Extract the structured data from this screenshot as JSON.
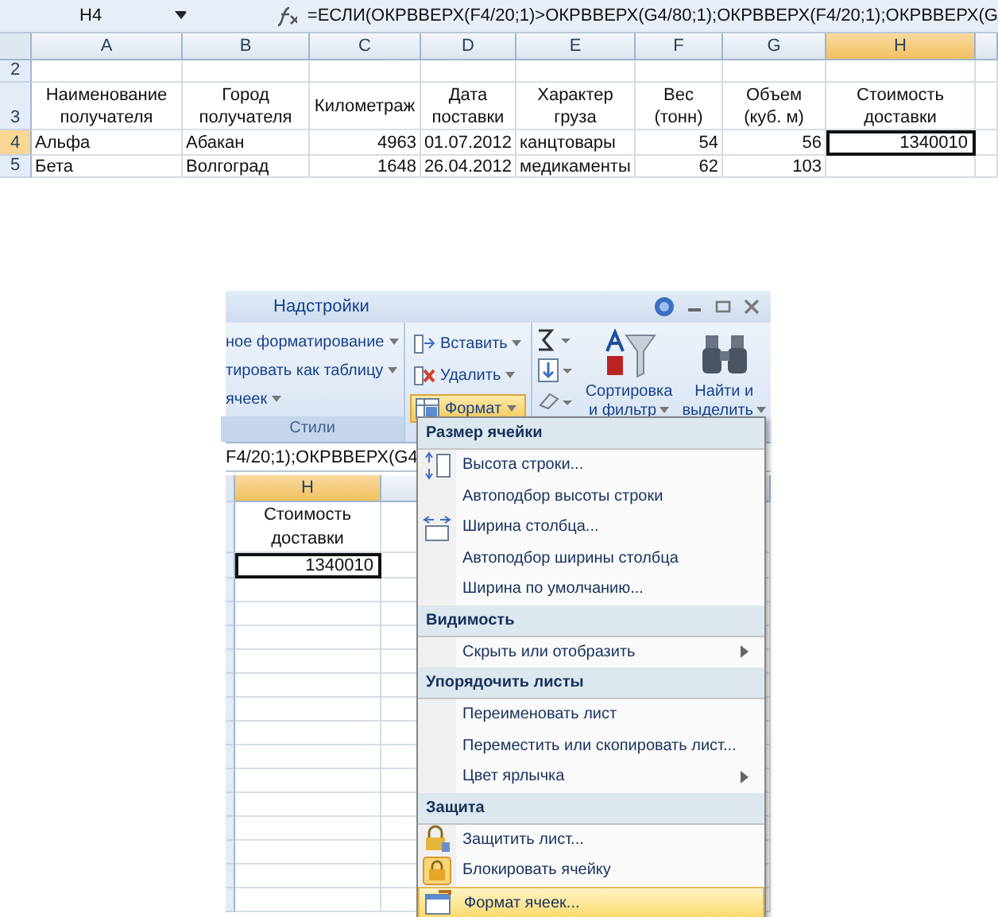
{
  "top_sheet": {
    "name_box": "H4",
    "formula": "=ЕСЛИ(ОКРВВЕРХ(F4/20;1)>ОКРВВЕРХ(G4/80;1);ОКРВВЕРХ(F4/20;1);ОКРВВЕРХ(G",
    "columns": [
      {
        "label": "A",
        "selected": false
      },
      {
        "label": "B",
        "selected": false
      },
      {
        "label": "C",
        "selected": false
      },
      {
        "label": "D",
        "selected": false
      },
      {
        "label": "E",
        "selected": false
      },
      {
        "label": "F",
        "selected": false
      },
      {
        "label": "G",
        "selected": false
      },
      {
        "label": "H",
        "selected": true
      }
    ],
    "rows": [
      {
        "number": "2",
        "selected": false,
        "cells": []
      },
      {
        "number": "3",
        "selected": false,
        "cells": [
          {
            "text": "Наименование получателя",
            "kind": "header"
          },
          {
            "text": "Город получателя",
            "kind": "header"
          },
          {
            "text": "Километраж",
            "kind": "header"
          },
          {
            "text": "Дата поставки",
            "kind": "header"
          },
          {
            "text": "Характер груза",
            "kind": "header"
          },
          {
            "text": "Вес (тонн)",
            "kind": "header"
          },
          {
            "text": "Объем (куб. м)",
            "kind": "header"
          },
          {
            "text": "Стоимость доставки",
            "kind": "header"
          }
        ]
      },
      {
        "number": "4",
        "selected": true,
        "cells": [
          {
            "text": "Альфа",
            "kind": "text",
            "active": false
          },
          {
            "text": "Абакан",
            "kind": "text",
            "active": false
          },
          {
            "text": "4963",
            "kind": "number",
            "active": false
          },
          {
            "text": "01.07.2012",
            "kind": "number",
            "active": false
          },
          {
            "text": "канцтовары",
            "kind": "text",
            "active": false
          },
          {
            "text": "54",
            "kind": "number",
            "active": false
          },
          {
            "text": "56",
            "kind": "number",
            "active": false
          },
          {
            "text": "1340010",
            "kind": "number",
            "active": true
          }
        ]
      },
      {
        "number": "5",
        "selected": false,
        "cells": [
          {
            "text": "Бета",
            "kind": "text",
            "active": false
          },
          {
            "text": "Волгоград",
            "kind": "text",
            "active": false
          },
          {
            "text": "1648",
            "kind": "number",
            "active": false
          },
          {
            "text": "26.04.2012",
            "kind": "number",
            "active": false
          },
          {
            "text": "медикаменты",
            "kind": "text",
            "active": false
          },
          {
            "text": "62",
            "kind": "number",
            "active": false
          },
          {
            "text": "103",
            "kind": "number",
            "active": false
          }
        ]
      }
    ]
  },
  "ribbon": {
    "tab": "Надстройки",
    "styles_group": {
      "items": [
        "ное форматирование",
        "тировать как таблицу",
        "ячеек"
      ],
      "label": "Стили"
    },
    "cells_group": [
      {
        "label": "Вставить",
        "kind": "insert",
        "selected": false
      },
      {
        "label": "Удалить",
        "kind": "delete",
        "selected": false
      },
      {
        "label": "Формат",
        "kind": "format",
        "selected": true
      }
    ],
    "editing_group": {
      "sort_label": [
        "Сортировка",
        "и фильтр"
      ],
      "find_label": [
        "Найти и",
        "выделить"
      ]
    }
  },
  "lower_sheet": {
    "formula": "F4/20;1);ОКРВВЕРХ(G4",
    "column": {
      "label": "H",
      "selected": true
    },
    "header_cell": "Стоимость доставки",
    "value_cell": "1340010"
  },
  "format_menu": {
    "sections": [
      {
        "title": "Размер ячейки",
        "items": [
          {
            "label": "Высота строки...",
            "kind": "rowheight",
            "submenu": false,
            "selected": false
          },
          {
            "label": "Автоподбор высоты строки",
            "kind": "plain",
            "submenu": false,
            "selected": false
          },
          {
            "label": "Ширина столбца...",
            "kind": "colwidth",
            "submenu": false,
            "selected": false
          },
          {
            "label": "Автоподбор ширины столбца",
            "kind": "plain",
            "submenu": false,
            "selected": false
          },
          {
            "label": "Ширина по умолчанию...",
            "kind": "plain",
            "submenu": false,
            "selected": false
          }
        ]
      },
      {
        "title": "Видимость",
        "items": [
          {
            "label": "Скрыть или отобразить",
            "kind": "plain",
            "submenu": true,
            "selected": false
          }
        ]
      },
      {
        "title": "Упорядочить листы",
        "items": [
          {
            "label": "Переименовать лист",
            "kind": "plain",
            "submenu": false,
            "selected": false
          },
          {
            "label": "Переместить или скопировать лист...",
            "kind": "plain",
            "submenu": false,
            "selected": false
          },
          {
            "label": "Цвет ярлычка",
            "kind": "plain",
            "submenu": true,
            "selected": false
          }
        ]
      },
      {
        "title": "Защита",
        "items": [
          {
            "label": "Защитить лист...",
            "kind": "locksheet",
            "submenu": false,
            "selected": false
          },
          {
            "label": "Блокировать ячейку",
            "kind": "lockcell",
            "submenu": false,
            "selected": false
          },
          {
            "label": "Формат ячеек...",
            "kind": "formatcells",
            "submenu": false,
            "selected": true
          }
        ]
      }
    ]
  }
}
